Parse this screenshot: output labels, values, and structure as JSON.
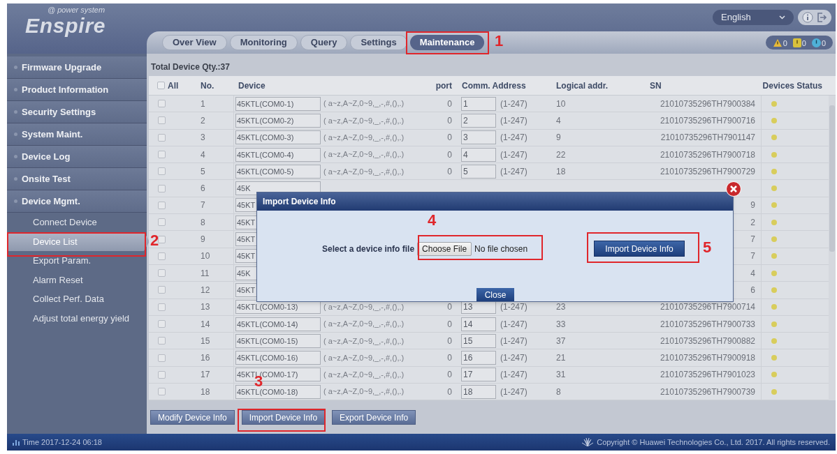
{
  "logo": {
    "tagline": "@ power system",
    "name": "Enspire"
  },
  "tabs": [
    {
      "label": "Over View",
      "selected": false
    },
    {
      "label": "Monitoring",
      "selected": false
    },
    {
      "label": "Query",
      "selected": false
    },
    {
      "label": "Settings",
      "selected": false
    },
    {
      "label": "Maintenance",
      "selected": true
    }
  ],
  "language": "English",
  "alarms": [
    {
      "kind": "major",
      "count": "0"
    },
    {
      "kind": "minor",
      "count": "0"
    },
    {
      "kind": "warning",
      "count": "0"
    }
  ],
  "sidebar": {
    "items": [
      {
        "label": "Firmware Upgrade",
        "kind": "section",
        "selected": false
      },
      {
        "label": "Product Information",
        "kind": "section",
        "selected": false
      },
      {
        "label": "Security Settings",
        "kind": "section",
        "selected": false
      },
      {
        "label": "System Maint.",
        "kind": "section",
        "selected": false
      },
      {
        "label": "Device Log",
        "kind": "section",
        "selected": false
      },
      {
        "label": "Onsite Test",
        "kind": "section",
        "selected": false
      },
      {
        "label": "Device Mgmt.",
        "kind": "section",
        "selected": false
      },
      {
        "label": "Connect Device",
        "kind": "subitem",
        "selected": false
      },
      {
        "label": "Device List",
        "kind": "subitem",
        "selected": true
      },
      {
        "label": "Export Param.",
        "kind": "subitem",
        "selected": false
      },
      {
        "label": "Alarm Reset",
        "kind": "subitem",
        "selected": false
      },
      {
        "label": "Collect Perf. Data",
        "kind": "subitem",
        "selected": false
      },
      {
        "label": "Adjust total energy yield",
        "kind": "subitem",
        "selected": false
      }
    ]
  },
  "total_label": "Total Device Qty.:37",
  "table": {
    "select_all": {
      "label": "All",
      "checked": false
    },
    "columns": [
      "No.",
      "Device",
      "port",
      "Comm. Address",
      "Logical addr.",
      "SN",
      "Devices Status"
    ],
    "rows": [
      {
        "checked": false,
        "no": "1",
        "device": "45KTL(COM0-1)",
        "hint": "( a~z,A~Z,0~9,_,-,#,(),.)",
        "port": "0",
        "address": "1",
        "range": "(1-247)",
        "logical": "10",
        "sn": "21010735296TH7900384"
      },
      {
        "checked": false,
        "no": "2",
        "device": "45KTL(COM0-2)",
        "hint": "( a~z,A~Z,0~9,_,-,#,(),.)",
        "port": "0",
        "address": "2",
        "range": "(1-247)",
        "logical": "4",
        "sn": "21010735296TH7900716"
      },
      {
        "checked": false,
        "no": "3",
        "device": "45KTL(COM0-3)",
        "hint": "( a~z,A~Z,0~9,_,-,#,(),.)",
        "port": "0",
        "address": "3",
        "range": "(1-247)",
        "logical": "9",
        "sn": "21010735296TH7901147"
      },
      {
        "checked": false,
        "no": "4",
        "device": "45KTL(COM0-4)",
        "hint": "( a~z,A~Z,0~9,_,-,#,(),.)",
        "port": "0",
        "address": "4",
        "range": "(1-247)",
        "logical": "22",
        "sn": "21010735296TH7900718"
      },
      {
        "checked": false,
        "no": "5",
        "device": "45KTL(COM0-5)",
        "hint": "( a~z,A~Z,0~9,_,-,#,(),.)",
        "port": "0",
        "address": "5",
        "range": "(1-247)",
        "logical": "18",
        "sn": "21010735296TH7900729"
      },
      {
        "checked": false,
        "no": "6",
        "device": "45K"
      },
      {
        "checked": false,
        "no": "7",
        "device": "45KT",
        "sn": "9"
      },
      {
        "checked": false,
        "no": "8",
        "device": "45KT",
        "sn": "2"
      },
      {
        "checked": false,
        "no": "9",
        "device": "45KT",
        "sn": "7"
      },
      {
        "checked": false,
        "no": "10",
        "device": "45KT",
        "sn": "7"
      },
      {
        "checked": false,
        "no": "11",
        "device": "45K",
        "sn": "4"
      },
      {
        "checked": false,
        "no": "12",
        "device": "45KT",
        "sn": "6"
      },
      {
        "checked": false,
        "no": "13",
        "device": "45KTL(COM0-13)",
        "hint": "( a~z,A~Z,0~9,_,-,#,(),.)",
        "port": "0",
        "address": "13",
        "range": "(1-247)",
        "logical": "23",
        "sn": "21010735296TH7900714"
      },
      {
        "checked": false,
        "no": "14",
        "device": "45KTL(COM0-14)",
        "hint": "( a~z,A~Z,0~9,_,-,#,(),.)",
        "port": "0",
        "address": "14",
        "range": "(1-247)",
        "logical": "33",
        "sn": "21010735296TH7900733"
      },
      {
        "checked": false,
        "no": "15",
        "device": "45KTL(COM0-15)",
        "hint": "( a~z,A~Z,0~9,_,-,#,(),.)",
        "port": "0",
        "address": "15",
        "range": "(1-247)",
        "logical": "37",
        "sn": "21010735296TH7900882"
      },
      {
        "checked": false,
        "no": "16",
        "device": "45KTL(COM0-16)",
        "hint": "( a~z,A~Z,0~9,_,-,#,(),.)",
        "port": "0",
        "address": "16",
        "range": "(1-247)",
        "logical": "21",
        "sn": "21010735296TH7900918"
      },
      {
        "checked": false,
        "no": "17",
        "device": "45KTL(COM0-17)",
        "hint": "( a~z,A~Z,0~9,_,-,#,(),.)",
        "port": "0",
        "address": "17",
        "range": "(1-247)",
        "logical": "31",
        "sn": "21010735296TH7901023"
      },
      {
        "checked": false,
        "no": "18",
        "device": "45KTL(COM0-18)",
        "hint": "( a~z,A~Z,0~9,_,-,#,(),.)",
        "port": "0",
        "address": "18",
        "range": "(1-247)",
        "logical": "8",
        "sn": "21010735296TH7900739"
      }
    ]
  },
  "buttons": [
    "Modify Device Info",
    "Import Device Info",
    "Export Device Info"
  ],
  "dialog": {
    "title": "Import Device Info",
    "prompt": "Select a device info file",
    "file_button": "Choose File",
    "file_status": "No file chosen",
    "import_button": "Import Device Info",
    "close_button": "Close"
  },
  "annotations": [
    {
      "label": "1"
    },
    {
      "label": "2"
    },
    {
      "label": "3"
    },
    {
      "label": "4"
    },
    {
      "label": "5"
    }
  ],
  "status_bar": {
    "time": "Time 2017-12-24 06:18",
    "copyright": "Copyright © Huawei Technologies Co., Ltd. 2017. All rights reserved."
  }
}
